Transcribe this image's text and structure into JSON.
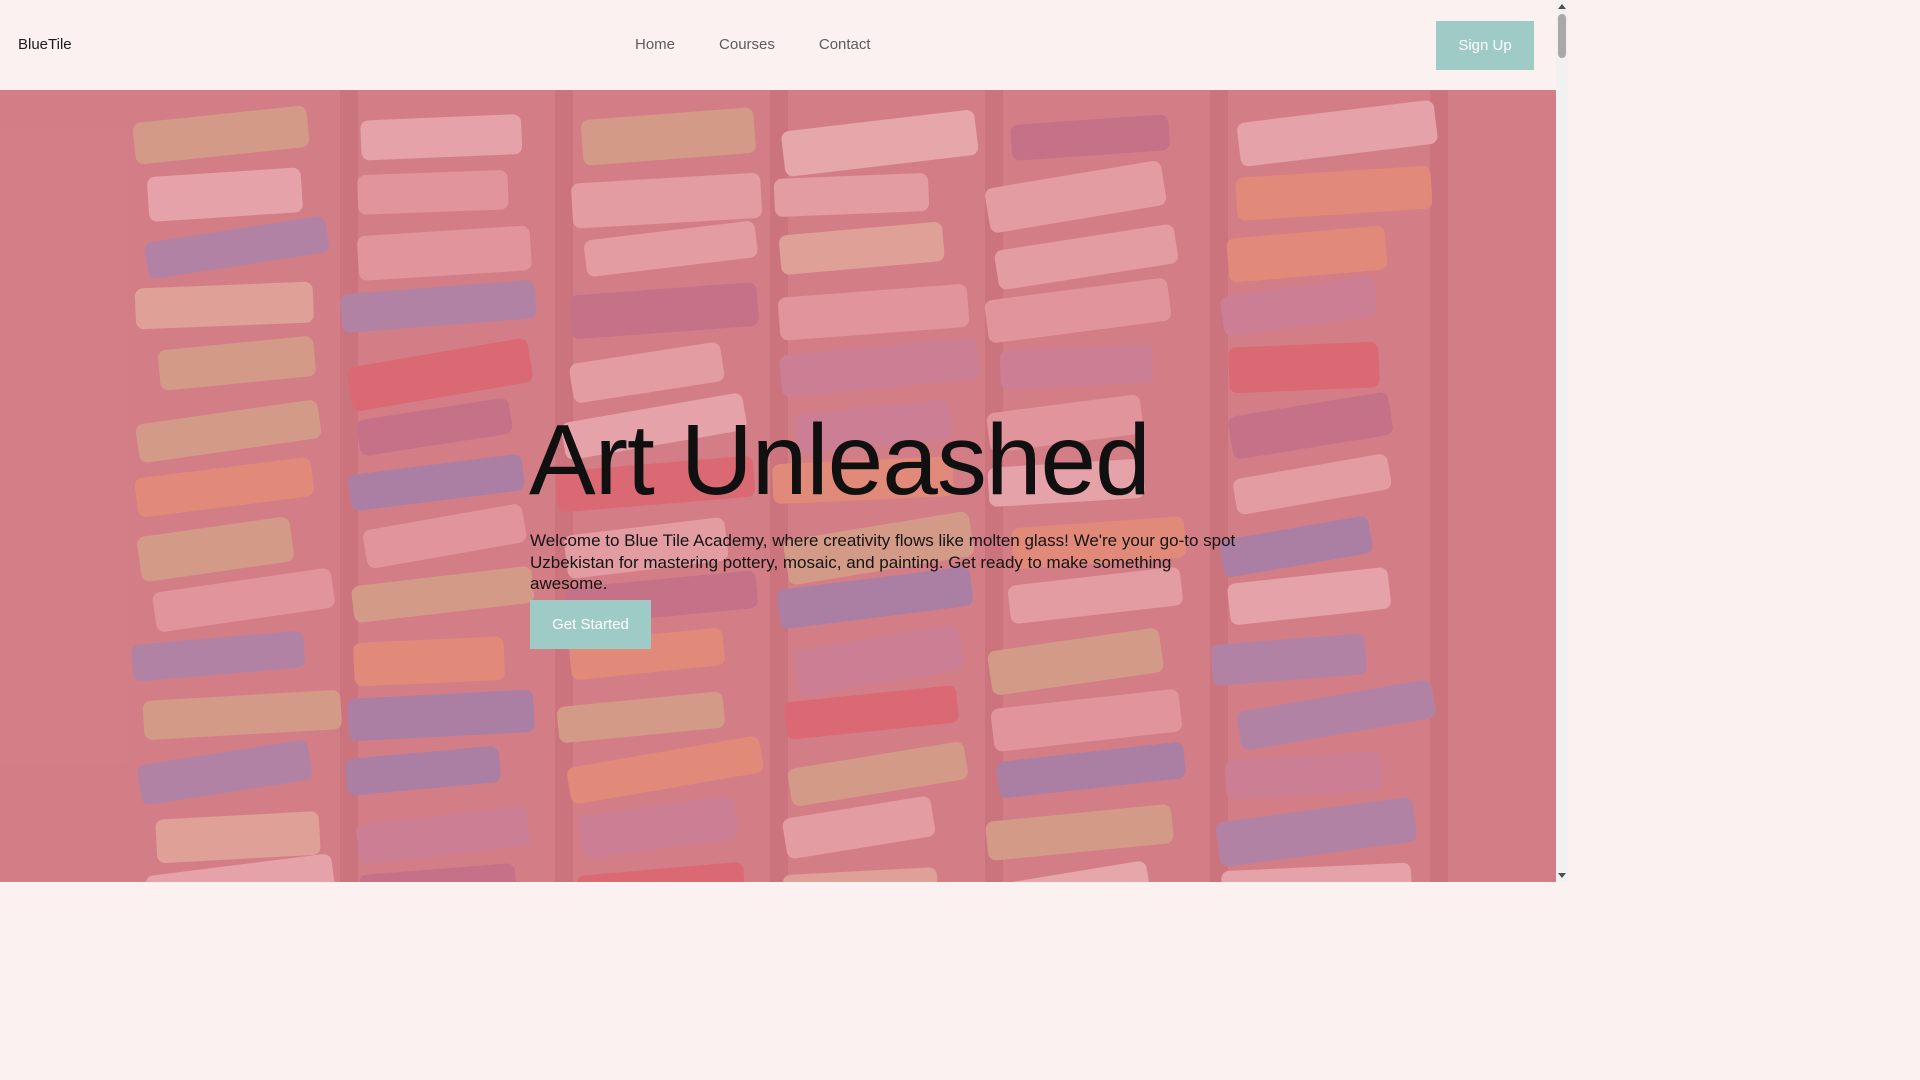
{
  "header": {
    "logo": "BlueTile",
    "nav": [
      {
        "label": "Home"
      },
      {
        "label": "Courses"
      },
      {
        "label": "Contact"
      }
    ],
    "signup_label": "Sign Up"
  },
  "hero": {
    "title": "Art Unleashed",
    "text": "Welcome to Blue Tile Academy, where creativity flows like molten glass! We're your go-to spot Uzbekistan for mastering pottery, mosaic, and painting. Get ready to make something awesome.",
    "cta_label": "Get Started",
    "background": "chalk-pastels-photo"
  },
  "colors": {
    "header_bg": "#fcf1f1",
    "button": "#9fcbc6",
    "button_text": "#ffffff",
    "hero_tint": "#dd7884"
  }
}
